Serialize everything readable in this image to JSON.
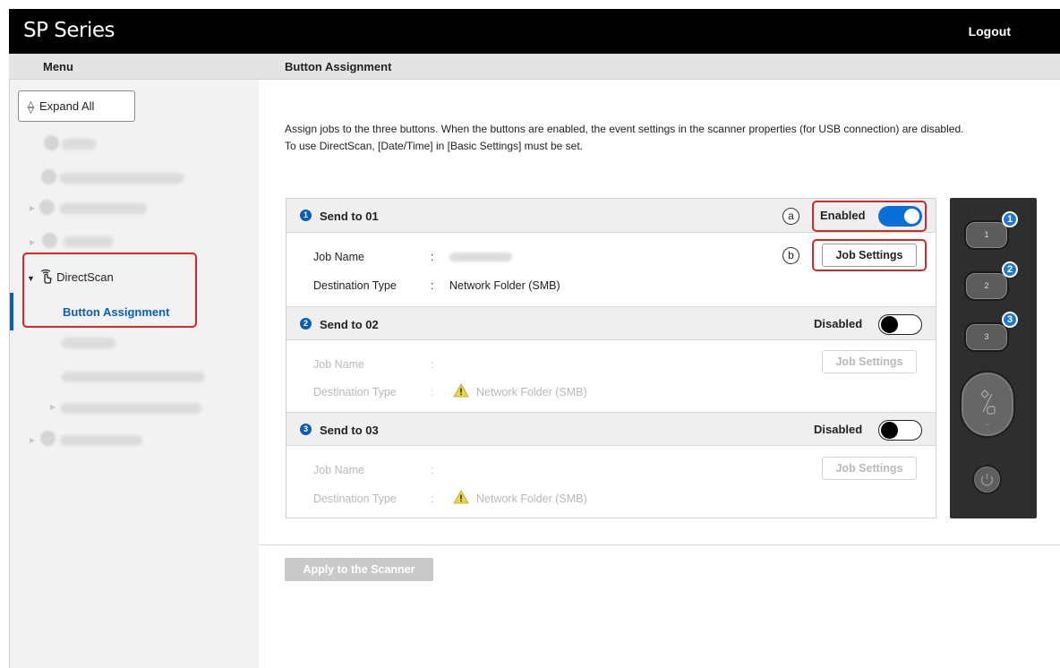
{
  "app": {
    "title": "SP Series",
    "logout_label": "Logout"
  },
  "header": {
    "menu_title": "Menu",
    "page_title": "Button Assignment"
  },
  "sidebar": {
    "expand_all_label": "Expand All",
    "items": [
      {
        "label": "Home",
        "icon": "home-icon",
        "legible": false
      },
      {
        "label": "Scanner Information",
        "icon": "info-icon",
        "legible": false
      },
      {
        "label": "Basic Settings",
        "icon": "gear-icon",
        "legible": false
      },
      {
        "label": "Network",
        "icon": "network-icon",
        "legible": false
      },
      {
        "label": "DirectScan",
        "icon": "directscan-icon",
        "legible": true,
        "expanded": true
      },
      {
        "label": "Button Assignment",
        "legible": true,
        "active": true
      },
      {
        "label": "Batch Log",
        "legible": false
      },
      {
        "label": "DirectScan Factory Reset",
        "legible": false
      },
      {
        "label": "External Server Settings",
        "legible": false
      },
      {
        "label": "Maintenance",
        "icon": "wrench-icon",
        "legible": false
      }
    ]
  },
  "intro": {
    "line1": "Assign jobs to the three buttons. When the buttons are enabled, the event settings in the scanner properties (for USB connection) are disabled.",
    "line2": "To use DirectScan, [Date/Time] in [Basic Settings] must be set."
  },
  "sections": [
    {
      "num": "1",
      "title": "Send to 01",
      "state": "Enabled",
      "enabled": true,
      "job_name_label": "Job Name",
      "job_name_value": "",
      "dest_label": "Destination Type",
      "dest_value": "Network Folder (SMB)",
      "sep": ":",
      "button_label": "Job Settings"
    },
    {
      "num": "2",
      "title": "Send to 02",
      "state": "Disabled",
      "enabled": false,
      "job_name_label": "Job Name",
      "job_name_value": "",
      "dest_label": "Destination Type",
      "dest_value": "Network Folder (SMB)",
      "sep": ":",
      "button_label": "Job Settings"
    },
    {
      "num": "3",
      "title": "Send to 03",
      "state": "Disabled",
      "enabled": false,
      "job_name_label": "Job Name",
      "job_name_value": "",
      "dest_label": "Destination Type",
      "dest_value": "Network Folder (SMB)",
      "sep": ":",
      "button_label": "Job Settings"
    }
  ],
  "markers": {
    "a": "a",
    "b": "b"
  },
  "scanner_panel": {
    "button_labels": [
      "1",
      "2",
      "3"
    ],
    "badges": [
      "1",
      "2",
      "3"
    ]
  },
  "apply_label": "Apply to the Scanner",
  "colors": {
    "accent": "#0a6fd6",
    "highlight": "#d9262b",
    "topbar": "#000000"
  }
}
